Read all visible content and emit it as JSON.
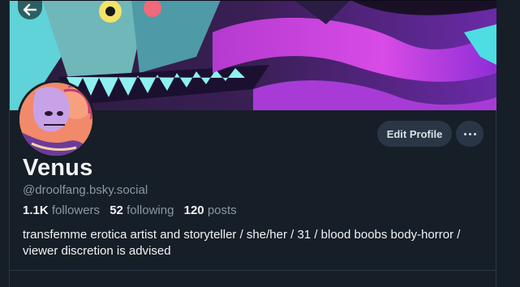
{
  "profile": {
    "display_name": "Venus",
    "handle": "@droolfang.bsky.social",
    "bio": "transfemme erotica artist and storyteller / she/her / 31 / blood boobs body-horror / viewer discretion is advised"
  },
  "stats": {
    "followers_count": "1.1K",
    "followers_label": "followers",
    "following_count": "52",
    "following_label": "following",
    "posts_count": "120",
    "posts_label": "posts"
  },
  "actions": {
    "edit_profile_label": "Edit Profile"
  },
  "icons": {
    "back": "arrow-left-icon",
    "more": "ellipsis-icon"
  },
  "colors": {
    "background": "#161e27",
    "button_bg": "#2a3646",
    "muted_text": "#8b98a5",
    "primary_text": "#f1f3f5"
  }
}
